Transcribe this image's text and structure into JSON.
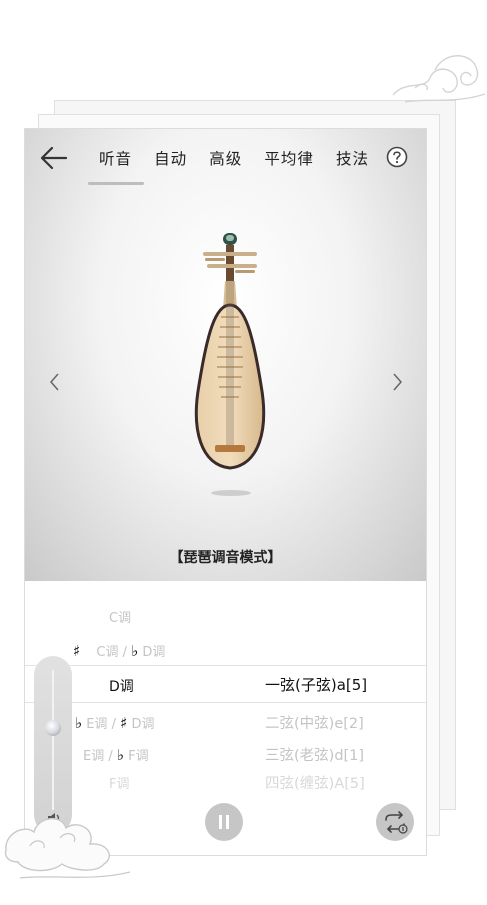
{
  "tabs": [
    "听音",
    "自动",
    "高级",
    "平均律",
    "技法"
  ],
  "active_tab": "听音",
  "instrument_caption": "【琵琶调音模式】",
  "key_rows": [
    {
      "key": "C调",
      "string": ""
    },
    {
      "key": "C调",
      "string": ""
    },
    {
      "key": "D调",
      "string": "一弦(子弦)a[5]"
    },
    {
      "key": "E调",
      "string": "二弦(中弦)e[2]"
    },
    {
      "key": "E调",
      "string": "三弦(老弦)d[1]"
    },
    {
      "key": "F调",
      "string": "四弦(缠弦)A[5]"
    }
  ],
  "alt_keys": {
    "row2": "D调",
    "row4": "D调",
    "row5": "F调"
  },
  "separator": "/",
  "icons": {
    "back": "back-arrow-icon",
    "help": "help-circle-icon",
    "prev": "chevron-left-icon",
    "next": "chevron-right-icon",
    "pause": "pause-icon",
    "loop": "loop-one-icon",
    "volume": "speaker-icon",
    "sharp": "sharp-icon",
    "flat": "flat-icon"
  },
  "volume_level": 0.6,
  "colors": {
    "accent_gray": "#c6c6c6",
    "text": "#222222",
    "faint_text": "#c4c4c4"
  }
}
